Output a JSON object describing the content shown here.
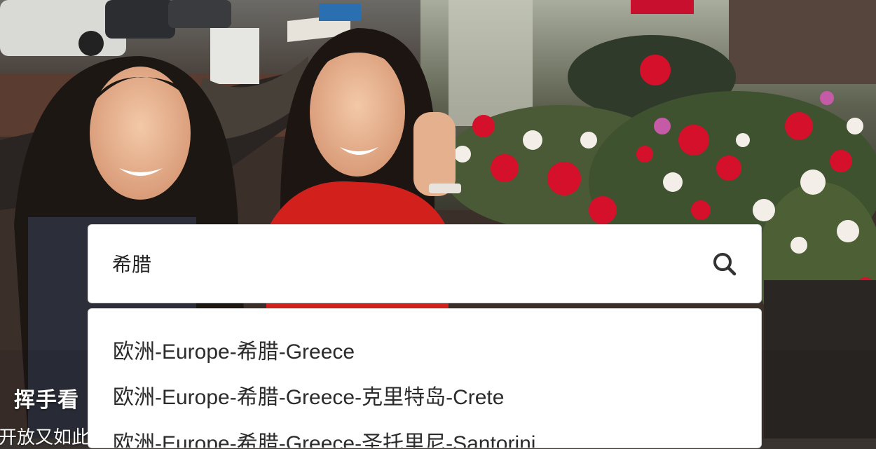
{
  "search": {
    "value": "希腊",
    "icon": "search-icon"
  },
  "suggestions": [
    {
      "label": "欧洲-Europe-希腊-Greece"
    },
    {
      "label": "欧洲-Europe-希腊-Greece-克里特岛-Crete"
    },
    {
      "label": "欧洲-Europe-希腊-Greece-圣托里尼-Santorini"
    }
  ],
  "caption": {
    "title": "挥手看",
    "subtitle": "开放又如此"
  }
}
